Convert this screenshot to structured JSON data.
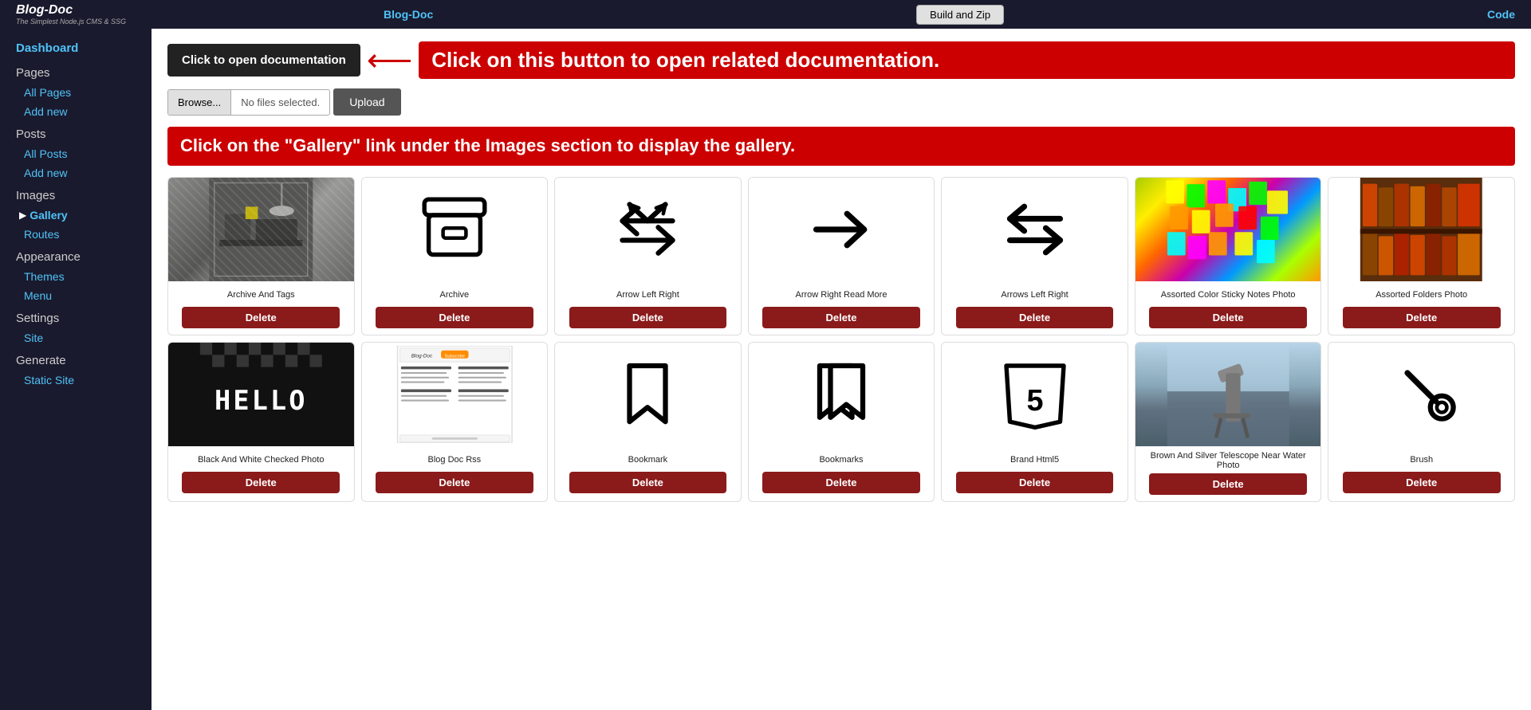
{
  "topnav": {
    "logo_name": "Blog-Doc",
    "logo_subtitle": "The Simplest Node.js CMS & SSG",
    "left_link": "Blog-Doc",
    "build_btn": "Build and Zip",
    "right_link": "Code"
  },
  "sidebar": {
    "dashboard": "Dashboard",
    "pages_title": "Pages",
    "all_pages": "All Pages",
    "add_page": "Add new",
    "posts_title": "Posts",
    "all_posts": "All Posts",
    "add_post": "Add new",
    "images_title": "Images",
    "gallery_label": "Gallery",
    "routes_label": "Routes",
    "appearance_title": "Appearance",
    "themes_label": "Themes",
    "menu_label": "Menu",
    "settings_title": "Settings",
    "site_label": "Site",
    "generate_title": "Generate",
    "static_site_label": "Static Site"
  },
  "main": {
    "doc_btn": "Click to open documentation",
    "red_banner_1": "Click on this button to open related documentation.",
    "file_placeholder": "No files selected.",
    "browse_btn": "Browse...",
    "upload_btn": "Upload",
    "gallery_banner": "Click on the \"Gallery\" link under the Images section to display the gallery.",
    "images": [
      {
        "name": "archive-and-tags",
        "title": "Archive And Tags",
        "type": "photo-dark"
      },
      {
        "name": "archive",
        "title": "Archive",
        "type": "icon-archive"
      },
      {
        "name": "arrow-left-right",
        "title": "Arrow Left Right",
        "type": "icon-arrow-lr"
      },
      {
        "name": "arrow-right-read-more",
        "title": "Arrow Right Read More",
        "type": "icon-arrow-r"
      },
      {
        "name": "arrows-left-right",
        "title": "Arrows Left Right",
        "type": "icon-arrows-lr"
      },
      {
        "name": "assorted-color-sticky-notes",
        "title": "Assorted Color Sticky Notes Photo",
        "type": "photo-sticky"
      },
      {
        "name": "assorted-folders",
        "title": "Assorted Folders Photo",
        "type": "photo-folders"
      },
      {
        "name": "black-white-checked",
        "title": "Black And White Checked Photo",
        "type": "photo-hello"
      },
      {
        "name": "blog-doc-rss",
        "title": "Blog Doc Rss",
        "type": "photo-blogdoc"
      },
      {
        "name": "bookmark",
        "title": "Bookmark",
        "type": "icon-bookmark"
      },
      {
        "name": "bookmarks",
        "title": "Bookmarks",
        "type": "icon-bookmarks"
      },
      {
        "name": "brand-html5",
        "title": "Brand Html5",
        "type": "icon-html5"
      },
      {
        "name": "brown-silver-telescope",
        "title": "Brown And Silver Telescope Near Water Photo",
        "type": "photo-telescope"
      },
      {
        "name": "brush",
        "title": "Brush",
        "type": "icon-brush"
      }
    ]
  }
}
